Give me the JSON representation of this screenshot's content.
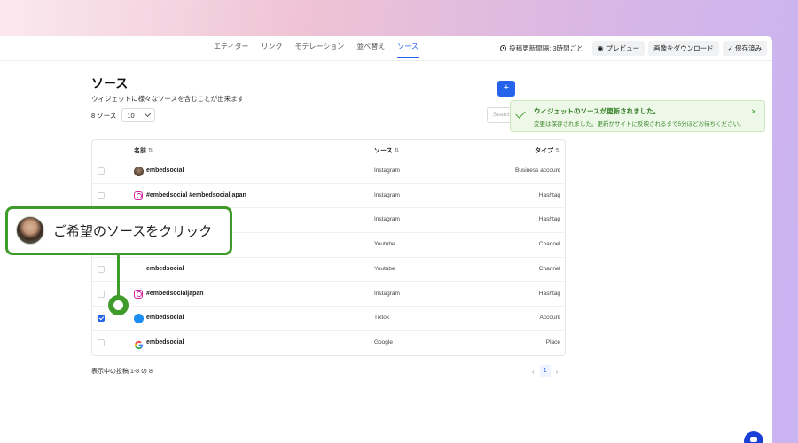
{
  "nav": {
    "tabs": [
      {
        "label": "エディター"
      },
      {
        "label": "リンク"
      },
      {
        "label": "モデレーション"
      },
      {
        "label": "並べ替え"
      },
      {
        "label": "ソース",
        "active": true
      }
    ],
    "schedule_text": "投稿更新間隔: 3時間ごと",
    "preview_label": "プレビュー",
    "download_label": "画像をダウンロード",
    "saved_label": "✓ 保存済み"
  },
  "page": {
    "title": "ソース",
    "subtitle": "ウィジェットに様々なソースを含むことが出来ます",
    "count_label": "8 ソース",
    "page_size": "10",
    "search_placeholder": "Search...",
    "add_label": "+"
  },
  "table": {
    "headers": {
      "name": "名前",
      "source": "ソース",
      "type": "タイプ",
      "sort": "⇅"
    },
    "rows": [
      {
        "name": "embedsocial",
        "source": "Instagram",
        "type": "Business account",
        "avatar": "photo",
        "checked": false
      },
      {
        "name": "#embedsocial #embedsocialjapan",
        "source": "Instagram",
        "type": "Hashtag",
        "avatar": "instagram-icon",
        "checked": false
      },
      {
        "name": "",
        "source": "Instagram",
        "type": "Hashtag",
        "avatar": "none",
        "checked": false
      },
      {
        "name": "",
        "source": "Youtube",
        "type": "Channel",
        "avatar": "none",
        "checked": false
      },
      {
        "name": "embedsocial",
        "source": "Youtube",
        "type": "Channel",
        "avatar": "none",
        "checked": false
      },
      {
        "name": "#embedsocialjapan",
        "source": "Instagram",
        "type": "Hashtag",
        "avatar": "instagram-icon",
        "checked": false
      },
      {
        "name": "embedsocial",
        "source": "Tiktok",
        "type": "Account",
        "avatar": "blue",
        "checked": true
      },
      {
        "name": "embedsocial",
        "source": "Google",
        "type": "Place",
        "avatar": "google-icon",
        "checked": false
      }
    ]
  },
  "footer": {
    "showing": "表示中の投稿 1-8 の 8",
    "page": "1",
    "prev": "‹",
    "next": "›"
  },
  "toast": {
    "title": "ウィジェットのソースが更新されました。",
    "body": "変更は保存されました。更新がサイトに反映されるまで5分ほどお待ちください。",
    "close": "×"
  },
  "callout": {
    "text": "ご希望のソースをクリック"
  },
  "colors": {
    "accent": "#2563eb",
    "callout_green": "#3f9b2a",
    "toast_bg": "#eef8e9"
  }
}
